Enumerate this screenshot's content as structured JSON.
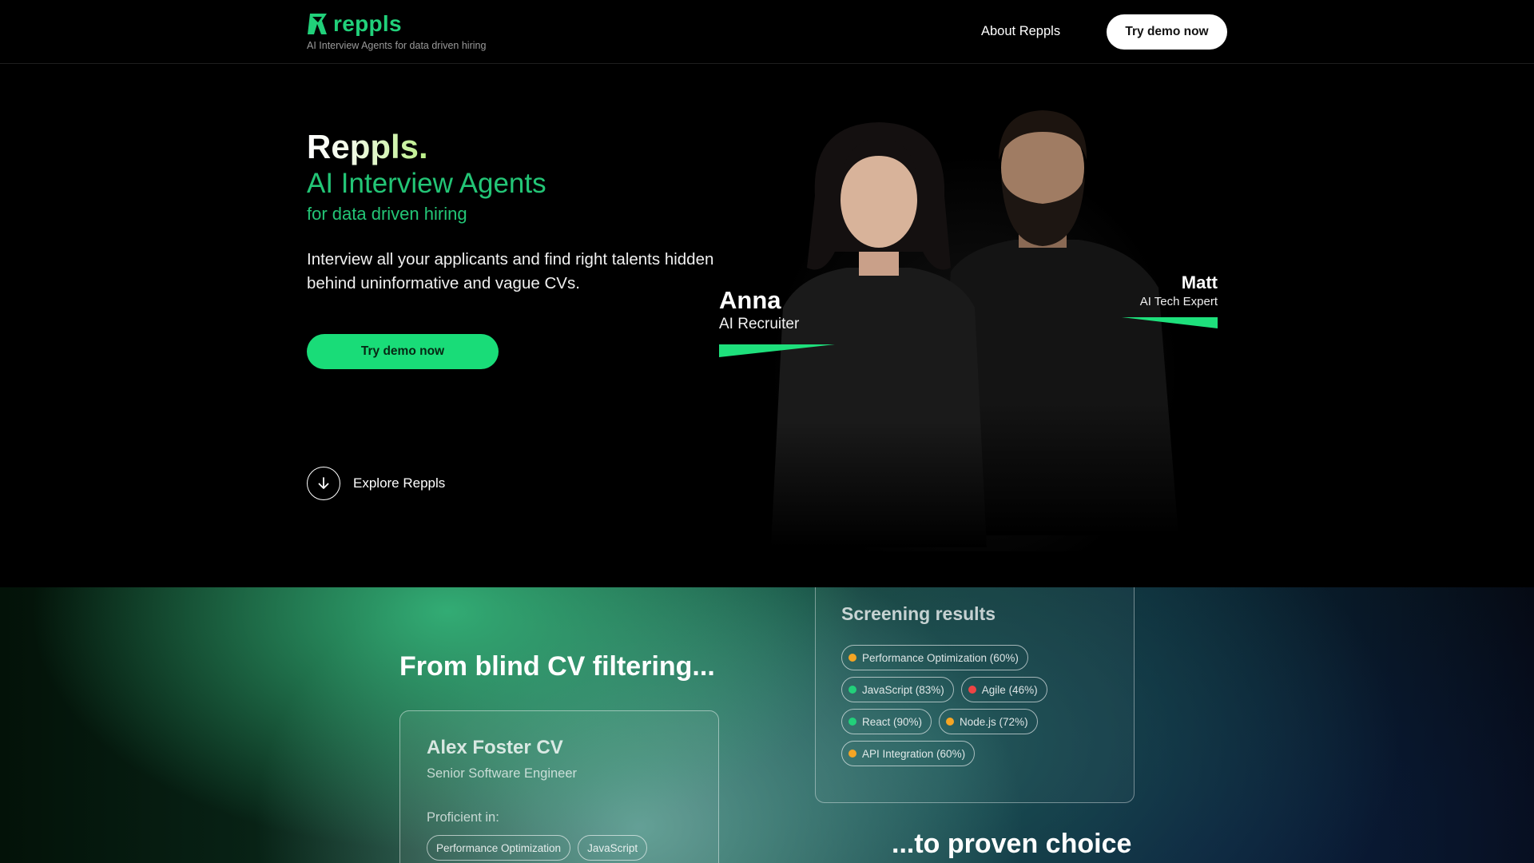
{
  "header": {
    "brand": "reppls",
    "tagline": "AI Interview Agents for data driven hiring",
    "nav_about": "About Reppls",
    "cta": "Try demo now",
    "brand_color": "#21d07a"
  },
  "hero": {
    "title": "Reppls.",
    "subtitle": "AI Interview Agents",
    "subtitle2": "for data driven hiring",
    "description": "Interview all your applicants and find right talents hidden behind uninformative and vague CVs.",
    "cta": "Try demo now",
    "explore": "Explore Reppls",
    "cta_color": "#19dc78"
  },
  "agents": {
    "anna": {
      "name": "Anna",
      "role": "AI Recruiter"
    },
    "matt": {
      "name": "Matt",
      "role": "AI Tech Expert"
    }
  },
  "compare": {
    "from_heading": "From blind CV filtering...",
    "to_heading": "...to proven choice",
    "cv": {
      "title": "Alex Foster CV",
      "role": "Senior Software Engineer",
      "proficient_label": "Proficient in:",
      "tags": [
        "Performance Optimization",
        "JavaScript"
      ]
    },
    "screening": {
      "title": "Screening results",
      "skills": [
        [
          {
            "label": "Performance Optimization (60%)",
            "status": "#f5a524"
          }
        ],
        [
          {
            "label": "JavaScript (83%)",
            "status": "#22d07a"
          },
          {
            "label": "Agile (46%)",
            "status": "#ef4444"
          }
        ],
        [
          {
            "label": "React (90%)",
            "status": "#22d07a"
          },
          {
            "label": "Node.js (72%)",
            "status": "#f5a524"
          }
        ],
        [
          {
            "label": "API Integration (60%)",
            "status": "#f5a524"
          }
        ]
      ]
    }
  }
}
